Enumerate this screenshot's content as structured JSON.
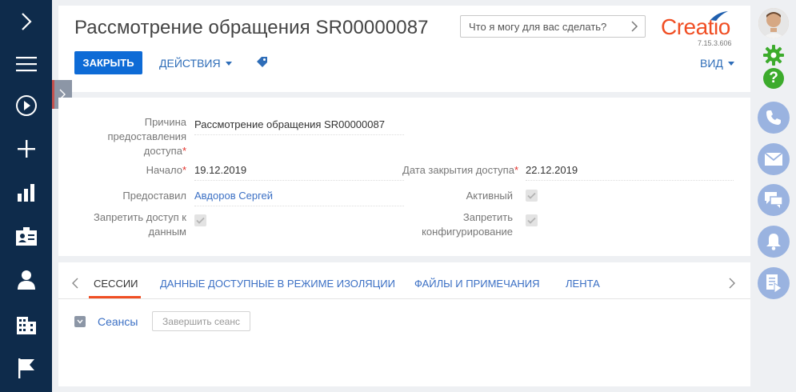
{
  "header": {
    "title": "Рассмотрение обращения SR00000087",
    "search_placeholder": "Что я могу для вас сделать?",
    "logo": "Creatio",
    "version": "7.15.3.606",
    "close_label": "ЗАКРЫТЬ",
    "actions_label": "ДЕЙСТВИЯ",
    "view_label": "ВИД"
  },
  "form": {
    "reason_label_1": "Причина",
    "reason_label_2": "предоставления",
    "reason_label_3": "доступа",
    "reason_value": "Рассмотрение обращения SR00000087",
    "start_label": "Начало",
    "start_value": "19.12.2019",
    "close_date_label": "Дата закрытия доступа",
    "close_date_value": "22.12.2019",
    "granted_by_label": "Предоставил",
    "granted_by_value": "Авдоров Сергей",
    "active_label": "Активный",
    "deny_access_label_1": "Запретить доступ к",
    "deny_access_label_2": "данным",
    "deny_config_label_1": "Запретить",
    "deny_config_label_2": "конфигурирование",
    "required_mark": "*"
  },
  "tabs": [
    {
      "label": "СЕССИИ"
    },
    {
      "label": "ДАННЫЕ ДОСТУПНЫЕ В РЕЖИМЕ ИЗОЛЯЦИИ"
    },
    {
      "label": "ФАЙЛЫ И ПРИМЕЧАНИЯ"
    },
    {
      "label": "ЛЕНТА"
    }
  ],
  "sessions": {
    "title": "Сеансы",
    "end_button": "Завершить сеанс"
  },
  "colors": {
    "sidebar": "#0e2b4b",
    "primary": "#0e6bd6",
    "link": "#3a6fc4",
    "brand": "#f04e23",
    "green": "#3cab2c",
    "comm": "#9ab3e0"
  },
  "icons": {
    "left": [
      "chevron-right-icon",
      "menu-icon",
      "play-icon",
      "plus-icon",
      "bar-chart-icon",
      "contact-card-icon",
      "person-icon",
      "building-icon",
      "flag-icon"
    ],
    "right": [
      "avatar",
      "gear-icon",
      "help-icon",
      "phone-icon",
      "mail-icon",
      "chat-icon",
      "bell-icon",
      "process-icon"
    ]
  }
}
